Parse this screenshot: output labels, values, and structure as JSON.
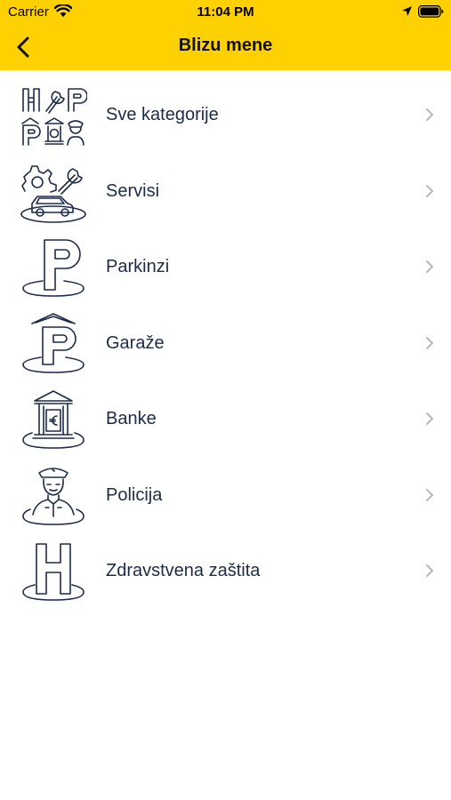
{
  "status_bar": {
    "carrier": "Carrier",
    "time": "11:04 PM",
    "icons": [
      "wifi-icon",
      "location-arrow-icon",
      "battery-icon"
    ]
  },
  "header": {
    "title": "Blizu mene",
    "back_icon": "chevron-left-icon",
    "background_color": "#ffd100"
  },
  "categories": [
    {
      "label": "Sve kategorije",
      "icon": "all-categories-icon"
    },
    {
      "label": "Servisi",
      "icon": "car-service-icon"
    },
    {
      "label": "Parkinzi",
      "icon": "parking-icon"
    },
    {
      "label": "Garaže",
      "icon": "garage-icon"
    },
    {
      "label": "Banke",
      "icon": "bank-icon"
    },
    {
      "label": "Policija",
      "icon": "police-icon"
    },
    {
      "label": "Zdravstvena zaštita",
      "icon": "hospital-icon"
    }
  ],
  "colors": {
    "accent": "#ffd100",
    "text": "#1c2b4a",
    "chevron": "#b8b8bd"
  }
}
